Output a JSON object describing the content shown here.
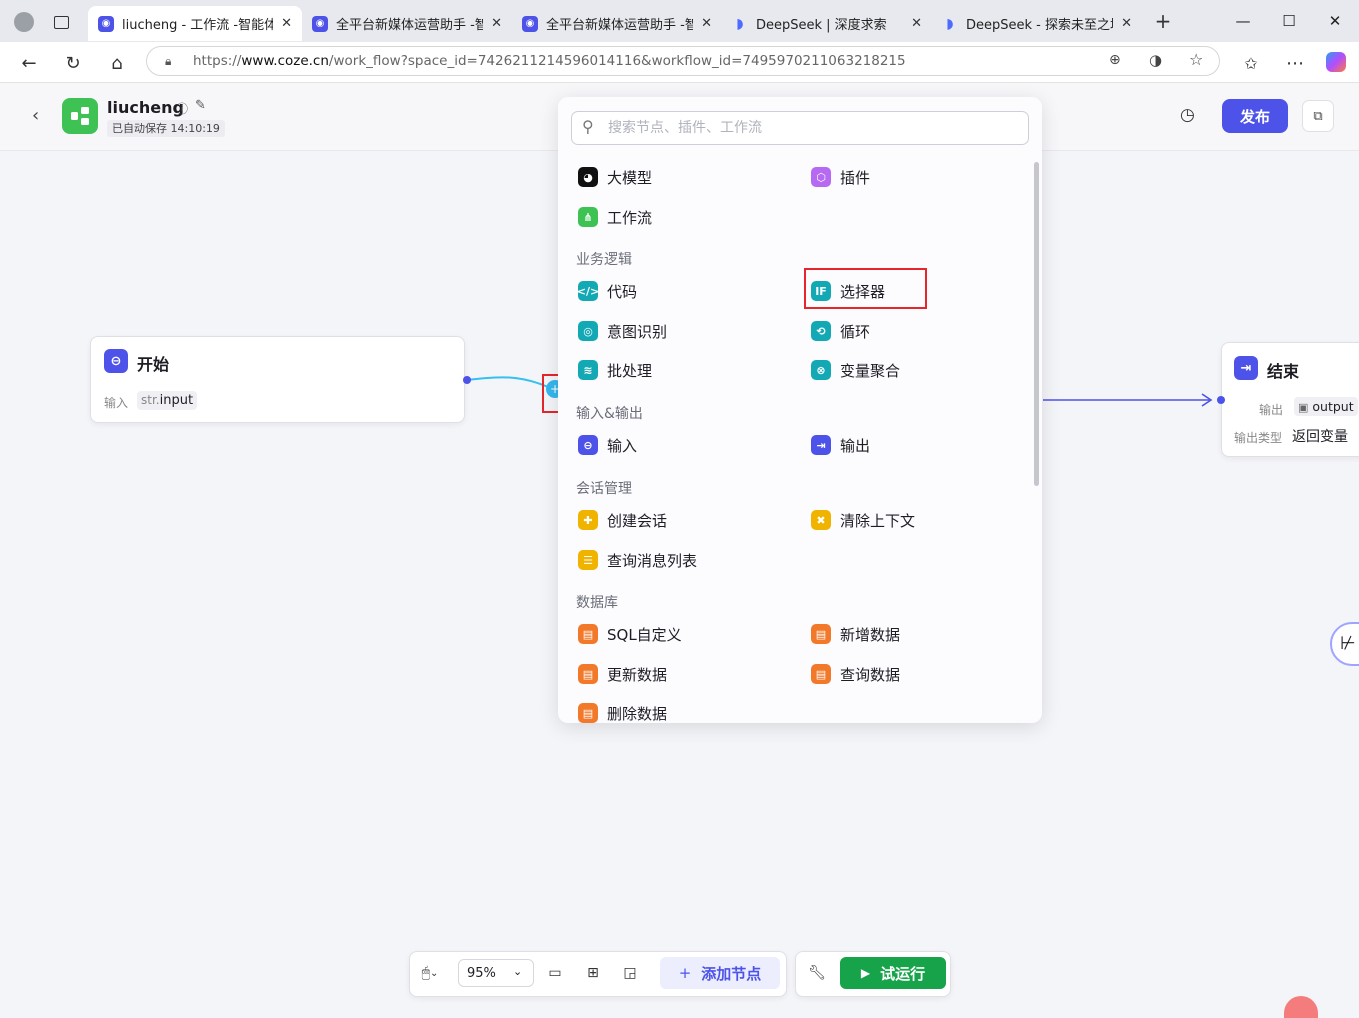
{
  "browser": {
    "tabs": [
      {
        "title": "liucheng - 工作流 -智能体平",
        "active": true
      },
      {
        "title": "全平台新媒体运营助手 -智能",
        "active": false
      },
      {
        "title": "全平台新媒体运营助手 -智能",
        "active": false
      },
      {
        "title": "DeepSeek | 深度求索",
        "active": false
      },
      {
        "title": "DeepSeek - 探索未至之境",
        "active": false
      }
    ],
    "url_prefix": "https://",
    "url_host": "www.coze.cn",
    "url_path": "/work_flow?space_id=7426211214596014116&workflow_id=7495970211063218215"
  },
  "header": {
    "workflow_name": "liucheng",
    "saved_status": "已自动保存 14:10:19",
    "publish_label": "发布"
  },
  "nodes": {
    "start": {
      "title": "开始",
      "input_label": "输入",
      "input_type": "str.",
      "input_name": "input"
    },
    "end": {
      "title": "结束",
      "output_label": "输出",
      "output_name": "output",
      "output_type_label": "输出类型",
      "output_type_value": "返回变量"
    }
  },
  "panel": {
    "search_placeholder": "搜索节点、插件、工作流",
    "top": [
      {
        "label": "大模型",
        "icon": "llm-icon",
        "color": "#111111"
      },
      {
        "label": "插件",
        "icon": "plugin-icon",
        "color": "#b66af2"
      },
      {
        "label": "工作流",
        "icon": "workflow-icon",
        "color": "#3ec254"
      }
    ],
    "sections": [
      {
        "title": "业务逻辑",
        "items": [
          {
            "label": "代码",
            "icon": "code-icon",
            "color": "#12a9b5"
          },
          {
            "label": "选择器",
            "icon": "if-icon",
            "color": "#12a9b5"
          },
          {
            "label": "意图识别",
            "icon": "intent-icon",
            "color": "#12a9b5"
          },
          {
            "label": "循环",
            "icon": "loop-icon",
            "color": "#12a9b5"
          },
          {
            "label": "批处理",
            "icon": "batch-icon",
            "color": "#12a9b5"
          },
          {
            "label": "变量聚合",
            "icon": "variable-merge-icon",
            "color": "#12a9b5"
          }
        ]
      },
      {
        "title": "输入&输出",
        "items": [
          {
            "label": "输入",
            "icon": "input-icon",
            "color": "#4d53e8"
          },
          {
            "label": "输出",
            "icon": "output-icon",
            "color": "#4d53e8"
          }
        ]
      },
      {
        "title": "会话管理",
        "items": [
          {
            "label": "创建会话",
            "icon": "create-chat-icon",
            "color": "#f0b400"
          },
          {
            "label": "清除上下文",
            "icon": "clear-context-icon",
            "color": "#f0b400"
          },
          {
            "label": "查询消息列表",
            "icon": "message-list-icon",
            "color": "#f0b400"
          }
        ]
      },
      {
        "title": "数据库",
        "items": [
          {
            "label": "SQL自定义",
            "icon": "sql-icon",
            "color": "#f2792a"
          },
          {
            "label": "新增数据",
            "icon": "add-data-icon",
            "color": "#f2792a"
          },
          {
            "label": "更新数据",
            "icon": "update-data-icon",
            "color": "#f2792a"
          },
          {
            "label": "查询数据",
            "icon": "query-data-icon",
            "color": "#f2792a"
          },
          {
            "label": "删除数据",
            "icon": "delete-data-icon",
            "color": "#f2792a"
          }
        ]
      }
    ]
  },
  "toolbar": {
    "zoom": "95%",
    "add_node_label": "添加节点",
    "run_label": "试运行"
  }
}
